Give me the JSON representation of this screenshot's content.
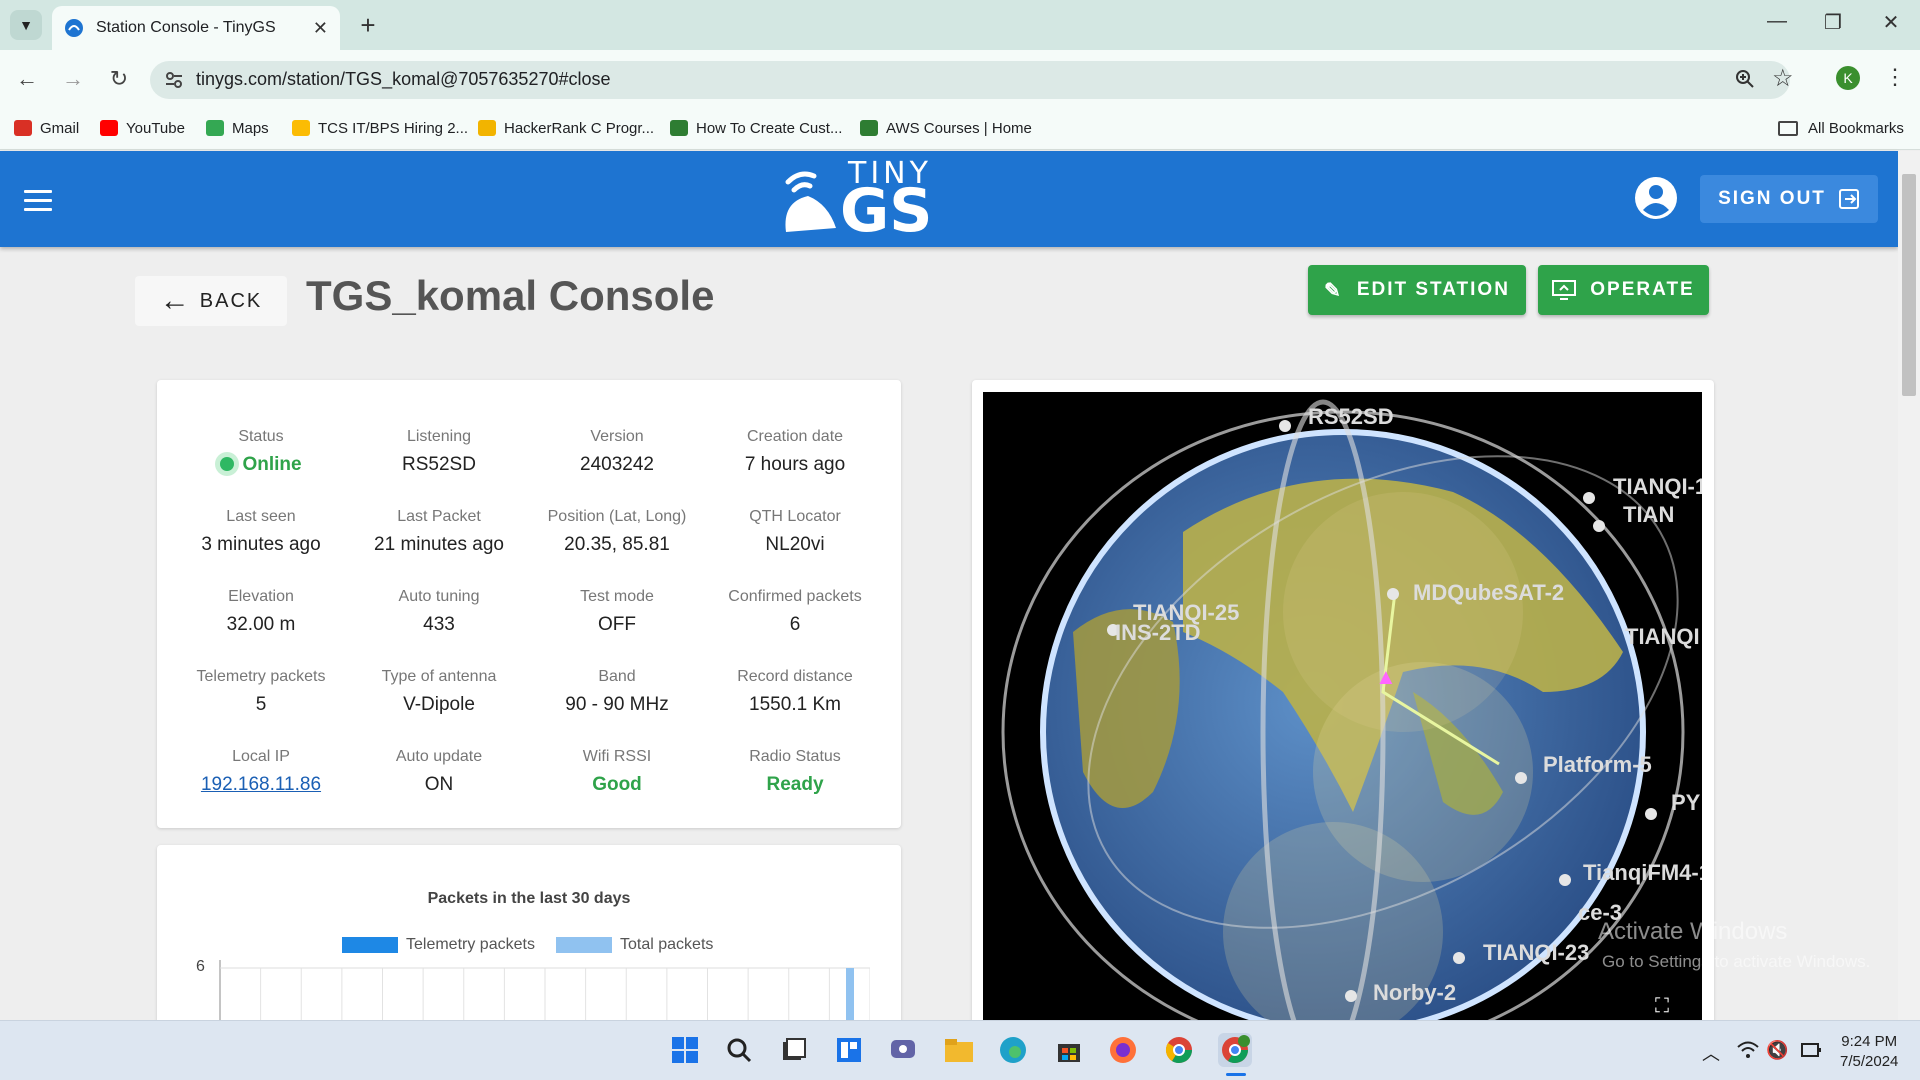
{
  "browser": {
    "tab_title": "Station Console - TinyGS",
    "url": "tinygs.com/station/TGS_komal@7057635270#close",
    "profile_initial": "K",
    "bookmarks": [
      {
        "label": "Gmail",
        "color": "#d93025"
      },
      {
        "label": "YouTube",
        "color": "#ff0000"
      },
      {
        "label": "Maps",
        "color": "#34a853"
      },
      {
        "label": "TCS IT/BPS Hiring 2...",
        "color": "#fbbc04"
      },
      {
        "label": "HackerRank C Progr...",
        "color": "#f2b400"
      },
      {
        "label": "How To Create Cust...",
        "color": "#2e7d32"
      },
      {
        "label": "AWS Courses | Home",
        "color": "#2e7d32"
      }
    ],
    "all_bookmarks": "All Bookmarks"
  },
  "header": {
    "logo_top": "TINY",
    "logo_bottom": "GS",
    "sign_out": "SIGN OUT"
  },
  "page": {
    "back": "BACK",
    "title": "TGS_komal Console",
    "edit_station": "EDIT STATION",
    "operate": "OPERATE"
  },
  "stats": [
    {
      "label": "Status",
      "value": "Online",
      "style": "status"
    },
    {
      "label": "Listening",
      "value": "RS52SD",
      "style": ""
    },
    {
      "label": "Version",
      "value": "2403242",
      "style": ""
    },
    {
      "label": "Creation date",
      "value": "7 hours ago",
      "style": ""
    },
    {
      "label": "Last seen",
      "value": "3 minutes ago",
      "style": ""
    },
    {
      "label": "Last Packet",
      "value": "21 minutes ago",
      "style": ""
    },
    {
      "label": "Position (Lat, Long)",
      "value": "20.35, 85.81",
      "style": ""
    },
    {
      "label": "QTH Locator",
      "value": "NL20vi",
      "style": ""
    },
    {
      "label": "Elevation",
      "value": "32.00 m",
      "style": ""
    },
    {
      "label": "Auto tuning",
      "value": "433",
      "style": ""
    },
    {
      "label": "Test mode",
      "value": "OFF",
      "style": ""
    },
    {
      "label": "Confirmed packets",
      "value": "6",
      "style": ""
    },
    {
      "label": "Telemetry packets",
      "value": "5",
      "style": ""
    },
    {
      "label": "Type of antenna",
      "value": "V-Dipole",
      "style": ""
    },
    {
      "label": "Band",
      "value": "90 - 90 MHz",
      "style": ""
    },
    {
      "label": "Record distance",
      "value": "1550.1 Km",
      "style": ""
    },
    {
      "label": "Local IP",
      "value": "192.168.11.86",
      "style": "link"
    },
    {
      "label": "Auto update",
      "value": "ON",
      "style": ""
    },
    {
      "label": "Wifi RSSI",
      "value": "Good",
      "style": "green"
    },
    {
      "label": "Radio Status",
      "value": "Ready",
      "style": "green"
    }
  ],
  "chart_data": {
    "type": "bar",
    "title": "Packets in the last 30 days",
    "series": [
      {
        "name": "Telemetry packets",
        "color": "#1e88e5"
      },
      {
        "name": "Total packets",
        "color": "#90c2f0"
      }
    ],
    "y_tick_top": "6",
    "ylim_top": 6,
    "last_bar_value": 6
  },
  "globe": {
    "satellites": [
      {
        "label": "RS52SD"
      },
      {
        "label": "TIANQI-1"
      },
      {
        "label": "TIAN"
      },
      {
        "label": "MDQubeSAT-2"
      },
      {
        "label": "TIANQI-25"
      },
      {
        "label": "INS-2TD"
      },
      {
        "label": "TIANQI"
      },
      {
        "label": "Platform-5"
      },
      {
        "label": "PY"
      },
      {
        "label": "TianqiFM4-1"
      },
      {
        "label": "ce-3"
      },
      {
        "label": "TIANQI-23"
      },
      {
        "label": "Norby-2"
      }
    ]
  },
  "watermark": {
    "line1": "Activate Windows",
    "line2": "Go to Settings to activate Windows."
  },
  "taskbar": {
    "time": "9:24 PM",
    "date": "7/5/2024"
  }
}
